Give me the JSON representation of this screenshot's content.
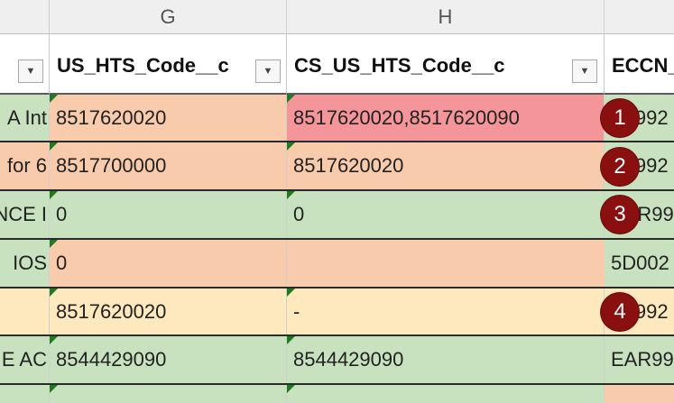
{
  "columns": {
    "g": "G",
    "h": "H"
  },
  "headers": {
    "f_tail": "",
    "g": "US_HTS_Code__c",
    "h": "CS_US_HTS_Code__c",
    "i": "ECCN_"
  },
  "rows": [
    {
      "f": "A Int",
      "g": "8517620020",
      "h": "8517620020,8517620090",
      "i": "5A992",
      "badge": "1"
    },
    {
      "f": "for 6",
      "g": "8517700000",
      "h": "8517620020",
      "i": "5A992",
      "badge": "2"
    },
    {
      "f": "NCE I",
      "g": "0",
      "h": "0",
      "i": "EAR99",
      "badge": "3"
    },
    {
      "f": "IOS",
      "g": "0",
      "h": "",
      "i": "5D002",
      "badge": ""
    },
    {
      "f": "",
      "g": "8517620020",
      "h": "-",
      "i": "5A992",
      "badge": "4"
    },
    {
      "f": "E AC",
      "g": "8544429090",
      "h": "8544429090",
      "i": "EAR99",
      "badge": ""
    },
    {
      "f": "",
      "g": "",
      "h": "",
      "i": "",
      "badge": ""
    }
  ],
  "colors": {
    "green": "#c8e2bf",
    "peach": "#f8cbad",
    "red": "#f4959a",
    "cream": "#fde9bd",
    "badge": "#8a0f0f"
  },
  "icons": {
    "filter": "filter-dropdown-icon",
    "comment": "green-triangle-indicator"
  }
}
